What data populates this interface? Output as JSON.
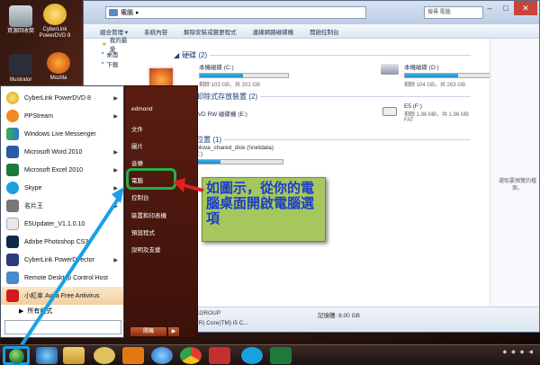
{
  "desktop": {
    "icons": [
      {
        "label": "資源回收筒"
      },
      {
        "label": "CyberLink PowerDVD 8"
      },
      {
        "label": "Illustrator"
      },
      {
        "label": "Mozilla"
      }
    ]
  },
  "explorer": {
    "address": "電腦",
    "search_placeholder": "搜尋 電腦",
    "toolbar": [
      "組合管理 ▾",
      "系統內容",
      "解除安裝或變更程式",
      "連線網路磁碟機",
      "開啟控制台"
    ],
    "nav": [
      "我的最愛",
      "桌面",
      "下載"
    ],
    "sections": {
      "hdd": "硬碟 (2)",
      "removable": "含有卸除式存放裝置 (2)",
      "network": "網路位置 (1)"
    },
    "drives": [
      {
        "name": "本機磁碟 (C:)",
        "meta": "剩餘 103 GB，共 201 GB",
        "fill": 0.49
      },
      {
        "name": "本機磁碟 (D:)",
        "meta": "剩餘 104 GB，共 263 GB",
        "fill": 0.6
      }
    ],
    "dvd": {
      "name": "DVD RW 磁碟機 (E:)"
    },
    "usb": {
      "name": "E5 (F:)",
      "meta": "剩餘 1.96 MB，共 1.96 MB",
      "fs": "FAT"
    },
    "netdrive": {
      "name": "xplova_shared_disk (\\\\netdata)",
      "letter": "(Z:)",
      "fill": 0.3
    },
    "preview_text": "選取要預覽的檔案。",
    "details": {
      "workgroup": "KGROUP",
      "memory": "記憶體: 8.00 GB",
      "cpu": "l(R) Core(TM) i5 C..."
    }
  },
  "startmenu": {
    "items": [
      {
        "label": "CyberLink PowerDVD 8",
        "arrow": true
      },
      {
        "label": "PPStream",
        "arrow": true
      },
      {
        "label": "Windows Live Messenger",
        "arrow": false
      },
      {
        "label": "Microsoft Word 2010",
        "arrow": true
      },
      {
        "label": "Microsoft Excel 2010",
        "arrow": true
      },
      {
        "label": "Skype",
        "arrow": true
      },
      {
        "label": "名片王",
        "arrow": true
      },
      {
        "label": "E5Updater_V1.1.0.10",
        "arrow": false
      },
      {
        "label": "Adobe Photoshop CS3",
        "arrow": false
      },
      {
        "label": "CyberLink PowerDirector",
        "arrow": true
      },
      {
        "label": "Remote Desktop Control Host",
        "arrow": false
      },
      {
        "label": "小紅傘 Avira Free Antivirus",
        "arrow": false
      }
    ],
    "all_programs": "所有程式",
    "right": [
      "edmond",
      "文件",
      "圖片",
      "音樂",
      "電腦",
      "控制台",
      "裝置和印表機",
      "預設程式",
      "說明及支援"
    ],
    "shutdown": "關機"
  },
  "annotation": {
    "text": "如圖示，從你的電腦桌面開啟電腦選項"
  }
}
